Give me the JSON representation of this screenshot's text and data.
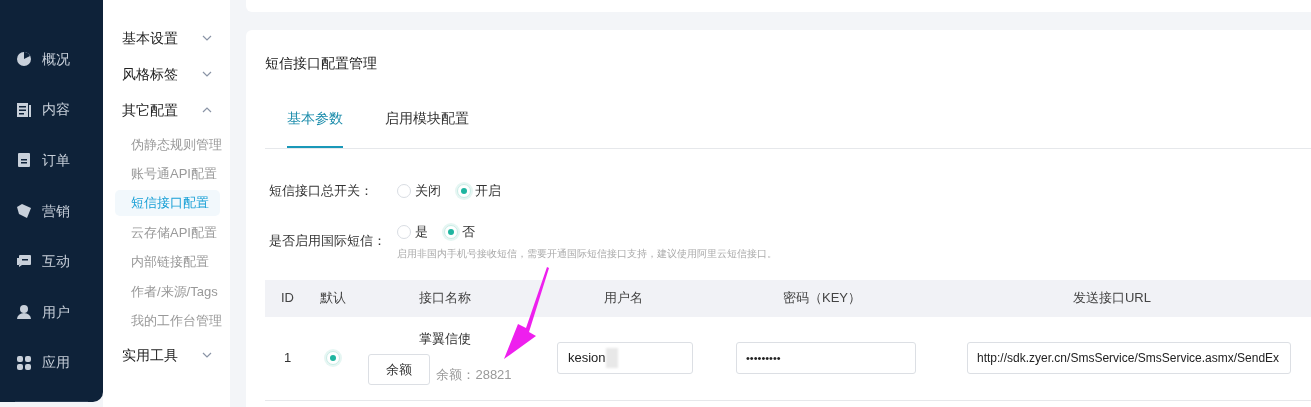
{
  "nav": [
    {
      "label": "概况",
      "selected": false
    },
    {
      "label": "内容",
      "selected": false
    },
    {
      "label": "订单",
      "selected": false
    },
    {
      "label": "营销",
      "selected": false
    },
    {
      "label": "互动",
      "selected": false
    },
    {
      "label": "用户",
      "selected": false
    },
    {
      "label": "应用",
      "selected": false
    }
  ],
  "submenu": [
    {
      "label": "基本设置",
      "expanded": false
    },
    {
      "label": "风格标签",
      "expanded": false
    },
    {
      "label": "其它配置",
      "expanded": true,
      "children": [
        {
          "label": "伪静态规则管理",
          "selected": false
        },
        {
          "label": "账号通API配置",
          "selected": false
        },
        {
          "label": "短信接口配置",
          "selected": true
        },
        {
          "label": "云存储API配置",
          "selected": false
        },
        {
          "label": "内部链接配置",
          "selected": false
        },
        {
          "label": "作者/来源/Tags",
          "selected": false
        },
        {
          "label": "我的工作台管理",
          "selected": false
        }
      ]
    },
    {
      "label": "实用工具",
      "expanded": false
    }
  ],
  "panel": {
    "title": "短信接口配置管理",
    "tabs": [
      {
        "label": "基本参数",
        "selected": true
      },
      {
        "label": "启用模块配置",
        "selected": false
      }
    ],
    "form": [
      {
        "label": "短信接口总开关：",
        "options": [
          {
            "label": "关闭",
            "selected": false
          },
          {
            "label": "开启",
            "selected": true
          }
        ]
      },
      {
        "label": "是否启用国际短信：",
        "options": [
          {
            "label": "是",
            "selected": false
          },
          {
            "label": "否",
            "selected": true
          }
        ],
        "hint": "启用非国内手机号接收短信，需要开通国际短信接口支持，建议使用阿里云短信接口。"
      }
    ],
    "table": {
      "columns": [
        "ID",
        "默认",
        "接口名称",
        "用户名",
        "密码（KEY）",
        "发送接口URL"
      ],
      "rows": [
        {
          "id": "1",
          "default": true,
          "name": "掌翼信使",
          "balance_button": "余额",
          "balance": "余额：28821",
          "username": "kesion",
          "password": "•••••••••",
          "url": "http://sdk.zyer.cn/SmsService/SmsService.asmx/SendEx"
        }
      ]
    }
  }
}
